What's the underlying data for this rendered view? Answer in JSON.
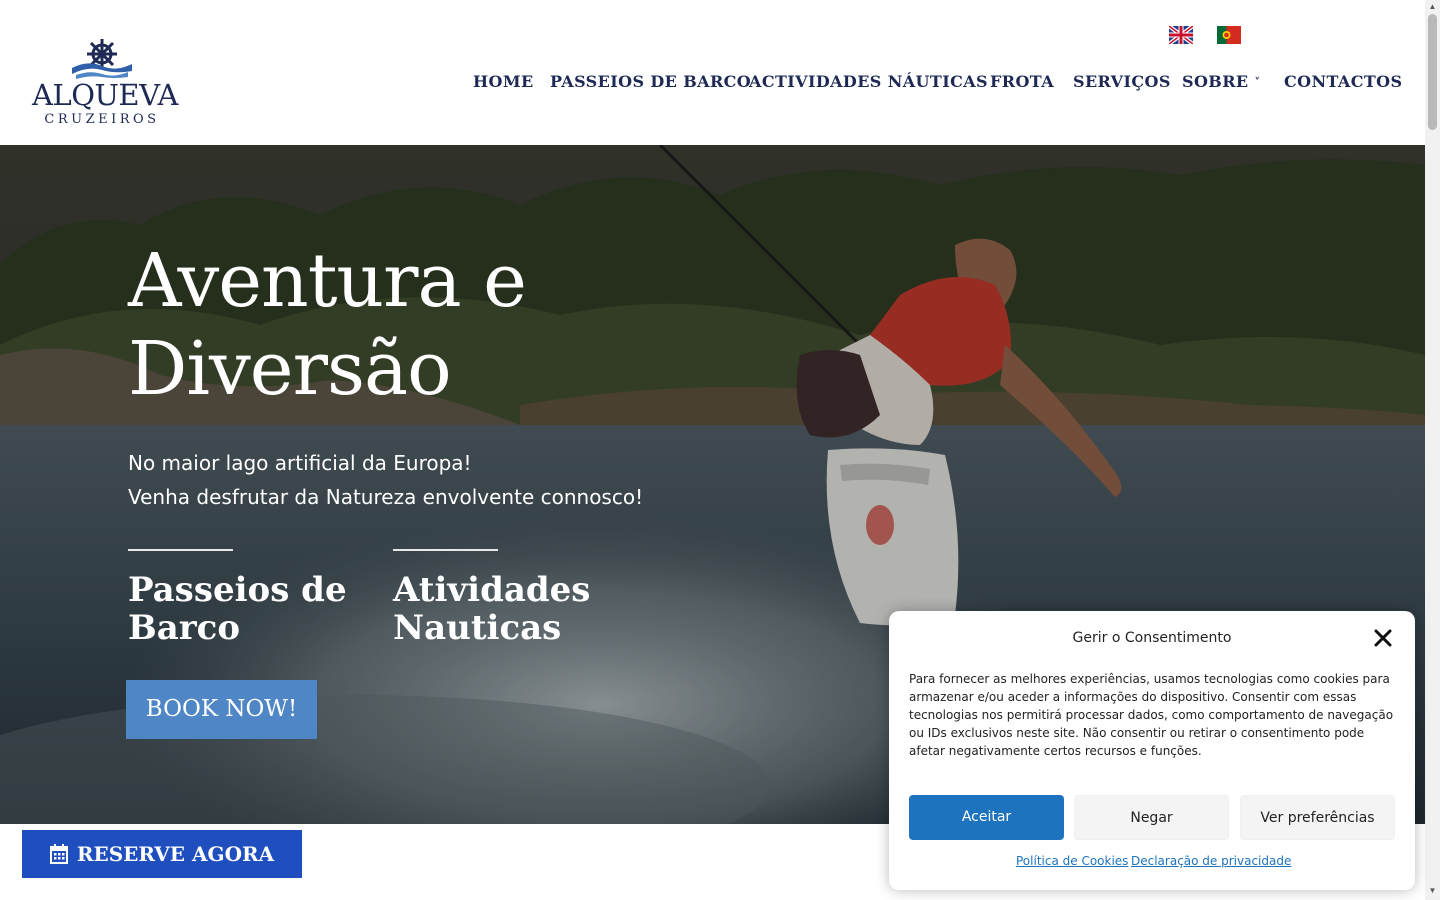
{
  "brand": {
    "name": "ALQUEVA",
    "subtitle": "CRUZEIROS"
  },
  "languages": [
    {
      "icon": "uk-flag-icon"
    },
    {
      "icon": "portugal-flag-icon"
    }
  ],
  "nav": {
    "items": [
      {
        "label": "HOME"
      },
      {
        "label": "PASSEIOS DE BARCO"
      },
      {
        "label": "ACTIVIDADES NÁUTICAS"
      },
      {
        "label": "FROTA"
      },
      {
        "label": "SERVIÇOS"
      },
      {
        "label": "SOBRE",
        "icon": "chevron-down-icon"
      },
      {
        "label": "CONTACTOS"
      }
    ]
  },
  "hero": {
    "title_line1": "Aventura e",
    "title_line2": "Diversão",
    "sub_line1": "No maior lago artificial da Europa!",
    "sub_line2": "Venha desfrutar da Natureza envolvente connosco!",
    "features": [
      {
        "line1": "Passeios de",
        "line2": "Barco"
      },
      {
        "line1": "Atividades",
        "line2": "Nauticas"
      }
    ],
    "book_label": "BOOK NOW!"
  },
  "reserve": {
    "label": "RESERVE AGORA",
    "icon": "calendar-icon"
  },
  "consent": {
    "title": "Gerir o Consentimento",
    "body": "Para fornecer as melhores experiências, usamos tecnologias como cookies para armazenar e/ou aceder a informações do dispositivo. Consentir com essas tecnologias nos permitirá processar dados, como comportamento de navegação ou IDs exclusivos neste site. Não consentir ou retirar o consentimento pode afetar negativamente certos recursos e funções.",
    "accept": "Aceitar",
    "deny": "Negar",
    "preferences": "Ver preferências",
    "cookie_policy": "Política de Cookies",
    "privacy": "Declaração de privacidade"
  },
  "colors": {
    "brand_navy": "#1e2a55",
    "book_button": "#4f86c6",
    "reserve_button": "#1f4fbf",
    "accept_button": "#1e73be"
  }
}
